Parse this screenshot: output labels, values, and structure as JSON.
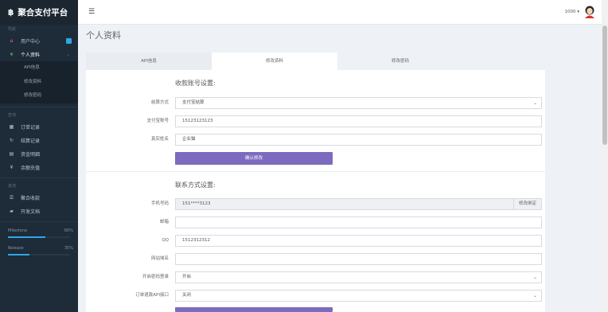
{
  "sidebar": {
    "brand": "聚合支付平台",
    "brand_symbol": "฿",
    "nav_heading": "导航",
    "items": [
      {
        "label": "用户中心"
      },
      {
        "label": "个人资料"
      }
    ],
    "sub_items": [
      "API信息",
      "修改资料",
      "修改密码"
    ],
    "records_heading": "查询",
    "records": [
      {
        "label": "订单记录",
        "icon": "grid-icon"
      },
      {
        "label": "结算记录",
        "icon": "refresh-icon"
      },
      {
        "label": "资金明细",
        "icon": "ledger-icon"
      },
      {
        "label": "余额充值",
        "icon": "yen-icon"
      }
    ],
    "other_heading": "其他",
    "others": [
      {
        "label": "聚合收款",
        "icon": "list-icon"
      },
      {
        "label": "开发文档",
        "icon": "book-icon"
      }
    ],
    "milestones": [
      {
        "label": "Milestone",
        "pct": "60%",
        "value": 0.6
      },
      {
        "label": "Release",
        "pct": "35%",
        "value": 0.35
      }
    ]
  },
  "topbar": {
    "menu_icon": "☰",
    "user_id": "1000 ▾"
  },
  "page_title": "个人资料",
  "tabs": [
    "API信息",
    "修改资料",
    "修改密码"
  ],
  "section1": {
    "title": "收款账号设置:",
    "settle_label": "结算方式",
    "settle_value": "支付宝结算",
    "account_label": "支付宝账号",
    "account_value": "15123123123",
    "name_label": "真实姓名",
    "name_value": "企业猫",
    "confirm_button": "确认修改"
  },
  "section2": {
    "title": "联系方式设置:",
    "phone_label": "手机号码",
    "phone_value": "151****3123",
    "phone_addon": "修改绑定",
    "email_label": "邮箱",
    "email_value": "",
    "qq_label": "QQ",
    "qq_value": "1512312312",
    "site_label": "网站域名",
    "site_value": "",
    "secure_login_label": "开启密码登录",
    "secure_login_value": "开启",
    "api_label": "订单退款API接口",
    "api_value": "关闭"
  },
  "colors": {
    "sidebar_bg": "#1e2b38",
    "primary_button": "#7c6bbf",
    "accent": "#2ea8e6"
  }
}
